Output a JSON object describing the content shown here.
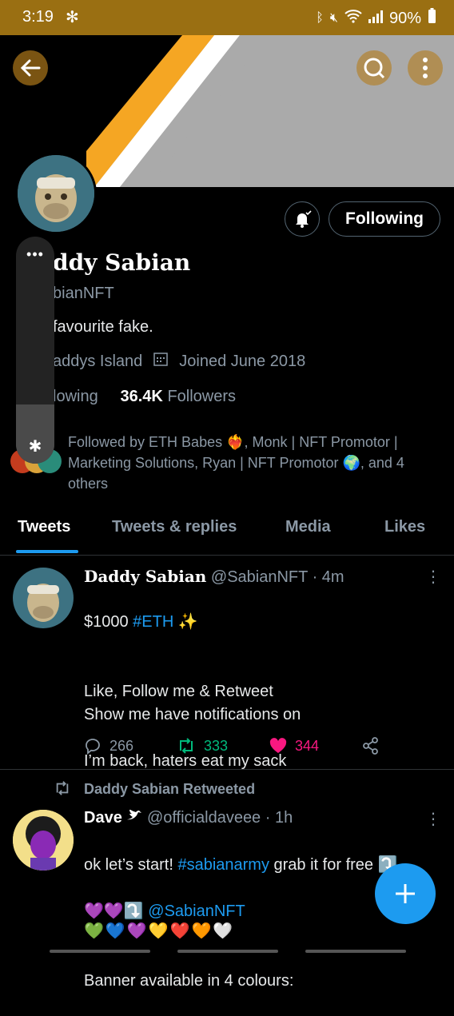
{
  "status_bar": {
    "time": "3:19",
    "battery": "90%"
  },
  "profile": {
    "name_partial": "ddy Sabian",
    "handle_partial": "bianNFT",
    "bio_partial": "favourite fake.",
    "location_partial": "addys Island",
    "joined": "Joined June 2018",
    "following_partial": "lowing",
    "followers_count": "36.4K",
    "followers_label": "Followers",
    "followed_by": "Followed by ETH Babes ❤️‍🔥, Monk | NFT Promotor | Marketing Solutions, Ryan | NFT Promotor 🌍, and 4 others",
    "following_button": "Following"
  },
  "tabs": [
    "Tweets",
    "Tweets & replies",
    "Media",
    "Likes"
  ],
  "tweet1": {
    "name": "Daddy Sabian",
    "handle": "@SabianNFT",
    "time": "· 4m",
    "line1_prefix": "$1000 ",
    "line1_tag": "#ETH",
    "line1_suffix": " ✨",
    "body_rest": "Like, Follow me & Retweet\nShow me have notifications on\n\nI’m back, haters eat my sack",
    "replies": "266",
    "retweets": "333",
    "likes": "344"
  },
  "retweeted_label": "Daddy Sabian Retweeted",
  "tweet2": {
    "name": "Dave",
    "handle": "@officialdaveee",
    "time": "· 1h",
    "line1_prefix": "ok let’s start! ",
    "line1_tag": "#sabianarmy",
    "line1_suffix": " grab it for free ⤵️",
    "line2_prefix": "💜💜⤵️ ",
    "line2_link": "@SabianNFT",
    "line3": "Banner available in 4 colours:",
    "line4": "💚💙💜💛❤️🧡🤍"
  },
  "colors": {
    "accent": "#1d9bf0",
    "like": "#f91880",
    "retweet": "#00ba7c",
    "statusbar": "#9a6f12"
  }
}
